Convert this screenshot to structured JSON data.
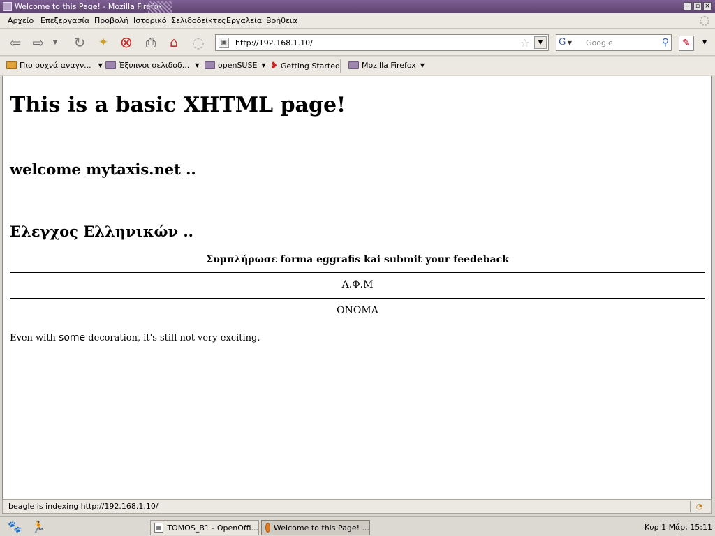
{
  "window": {
    "title": "Welcome to this Page! - Mozilla Firefox"
  },
  "menu": [
    "Αρχείο",
    "Επεξεργασία",
    "Προβολή",
    "Ιστορικό",
    "Σελιδοδείκτες",
    "Εργαλεία",
    "Βοήθεια"
  ],
  "nav": {
    "url": "http://192.168.1.10/",
    "search_placeholder": "Google",
    "search_engine_icon": "G"
  },
  "bookmarks": [
    {
      "label": "Πιο συχνά αναγν...",
      "icon": "rss-folder-icon",
      "has_menu": true
    },
    {
      "label": "Έξυπνοι σελιδοδ...",
      "icon": "folder-icon",
      "has_menu": true
    },
    {
      "label": "openSUSE",
      "icon": "folder-icon",
      "has_menu": true
    },
    {
      "label": "Getting Started",
      "icon": "chameleon-icon",
      "has_menu": false
    },
    {
      "label": "Mozilla Firefox",
      "icon": "folder-icon",
      "has_menu": true
    }
  ],
  "page": {
    "heading": "This is a basic XHTML page!",
    "subheading1": "welcome mytaxis.net ..",
    "subheading2": "Ελεγχος Ελληνικών ..",
    "table_caption": "Συμπλήρωσε forma eggrafis kai submit your feedeback",
    "row1": "Α.Φ.Μ",
    "row2": "ΟΝΟΜΑ",
    "para_before": "Even with ",
    "para_big": "some",
    "para_after": " decoration, it's still not very exciting."
  },
  "status": {
    "text": "beagle is indexing http://192.168.1.10/"
  },
  "taskbar": {
    "tasks": [
      {
        "label": "TOMOS_B1 - OpenOffi...",
        "active": false
      },
      {
        "label": "Welcome to this Page! ...",
        "active": true
      }
    ],
    "clock": "Κυρ  1 Μάρ, 15:11"
  },
  "colors": {
    "titlebar": "#6e5180",
    "chrome": "#ece9e3",
    "link_red": "#cc2222"
  }
}
